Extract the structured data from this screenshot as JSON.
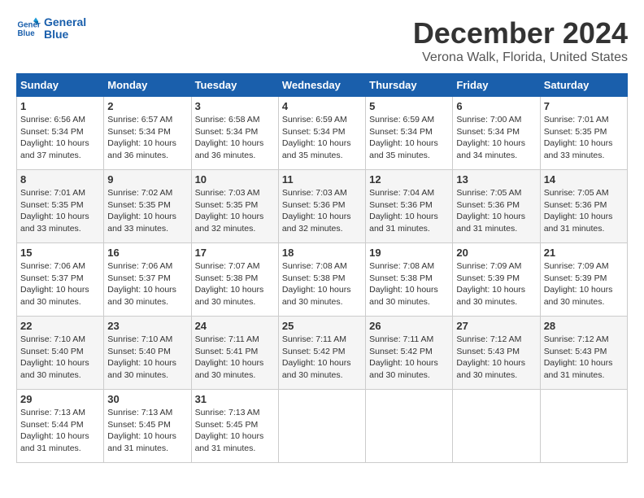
{
  "logo": {
    "line1": "General",
    "line2": "Blue"
  },
  "title": "December 2024",
  "location": "Verona Walk, Florida, United States",
  "days_header": [
    "Sunday",
    "Monday",
    "Tuesday",
    "Wednesday",
    "Thursday",
    "Friday",
    "Saturday"
  ],
  "weeks": [
    [
      {
        "day": "1",
        "sunrise": "6:56 AM",
        "sunset": "5:34 PM",
        "daylight": "10 hours and 37 minutes."
      },
      {
        "day": "2",
        "sunrise": "6:57 AM",
        "sunset": "5:34 PM",
        "daylight": "10 hours and 36 minutes."
      },
      {
        "day": "3",
        "sunrise": "6:58 AM",
        "sunset": "5:34 PM",
        "daylight": "10 hours and 36 minutes."
      },
      {
        "day": "4",
        "sunrise": "6:59 AM",
        "sunset": "5:34 PM",
        "daylight": "10 hours and 35 minutes."
      },
      {
        "day": "5",
        "sunrise": "6:59 AM",
        "sunset": "5:34 PM",
        "daylight": "10 hours and 35 minutes."
      },
      {
        "day": "6",
        "sunrise": "7:00 AM",
        "sunset": "5:34 PM",
        "daylight": "10 hours and 34 minutes."
      },
      {
        "day": "7",
        "sunrise": "7:01 AM",
        "sunset": "5:35 PM",
        "daylight": "10 hours and 33 minutes."
      }
    ],
    [
      {
        "day": "8",
        "sunrise": "7:01 AM",
        "sunset": "5:35 PM",
        "daylight": "10 hours and 33 minutes."
      },
      {
        "day": "9",
        "sunrise": "7:02 AM",
        "sunset": "5:35 PM",
        "daylight": "10 hours and 33 minutes."
      },
      {
        "day": "10",
        "sunrise": "7:03 AM",
        "sunset": "5:35 PM",
        "daylight": "10 hours and 32 minutes."
      },
      {
        "day": "11",
        "sunrise": "7:03 AM",
        "sunset": "5:36 PM",
        "daylight": "10 hours and 32 minutes."
      },
      {
        "day": "12",
        "sunrise": "7:04 AM",
        "sunset": "5:36 PM",
        "daylight": "10 hours and 31 minutes."
      },
      {
        "day": "13",
        "sunrise": "7:05 AM",
        "sunset": "5:36 PM",
        "daylight": "10 hours and 31 minutes."
      },
      {
        "day": "14",
        "sunrise": "7:05 AM",
        "sunset": "5:36 PM",
        "daylight": "10 hours and 31 minutes."
      }
    ],
    [
      {
        "day": "15",
        "sunrise": "7:06 AM",
        "sunset": "5:37 PM",
        "daylight": "10 hours and 30 minutes."
      },
      {
        "day": "16",
        "sunrise": "7:06 AM",
        "sunset": "5:37 PM",
        "daylight": "10 hours and 30 minutes."
      },
      {
        "day": "17",
        "sunrise": "7:07 AM",
        "sunset": "5:38 PM",
        "daylight": "10 hours and 30 minutes."
      },
      {
        "day": "18",
        "sunrise": "7:08 AM",
        "sunset": "5:38 PM",
        "daylight": "10 hours and 30 minutes."
      },
      {
        "day": "19",
        "sunrise": "7:08 AM",
        "sunset": "5:38 PM",
        "daylight": "10 hours and 30 minutes."
      },
      {
        "day": "20",
        "sunrise": "7:09 AM",
        "sunset": "5:39 PM",
        "daylight": "10 hours and 30 minutes."
      },
      {
        "day": "21",
        "sunrise": "7:09 AM",
        "sunset": "5:39 PM",
        "daylight": "10 hours and 30 minutes."
      }
    ],
    [
      {
        "day": "22",
        "sunrise": "7:10 AM",
        "sunset": "5:40 PM",
        "daylight": "10 hours and 30 minutes."
      },
      {
        "day": "23",
        "sunrise": "7:10 AM",
        "sunset": "5:40 PM",
        "daylight": "10 hours and 30 minutes."
      },
      {
        "day": "24",
        "sunrise": "7:11 AM",
        "sunset": "5:41 PM",
        "daylight": "10 hours and 30 minutes."
      },
      {
        "day": "25",
        "sunrise": "7:11 AM",
        "sunset": "5:42 PM",
        "daylight": "10 hours and 30 minutes."
      },
      {
        "day": "26",
        "sunrise": "7:11 AM",
        "sunset": "5:42 PM",
        "daylight": "10 hours and 30 minutes."
      },
      {
        "day": "27",
        "sunrise": "7:12 AM",
        "sunset": "5:43 PM",
        "daylight": "10 hours and 30 minutes."
      },
      {
        "day": "28",
        "sunrise": "7:12 AM",
        "sunset": "5:43 PM",
        "daylight": "10 hours and 31 minutes."
      }
    ],
    [
      {
        "day": "29",
        "sunrise": "7:13 AM",
        "sunset": "5:44 PM",
        "daylight": "10 hours and 31 minutes."
      },
      {
        "day": "30",
        "sunrise": "7:13 AM",
        "sunset": "5:45 PM",
        "daylight": "10 hours and 31 minutes."
      },
      {
        "day": "31",
        "sunrise": "7:13 AM",
        "sunset": "5:45 PM",
        "daylight": "10 hours and 31 minutes."
      },
      null,
      null,
      null,
      null
    ]
  ]
}
